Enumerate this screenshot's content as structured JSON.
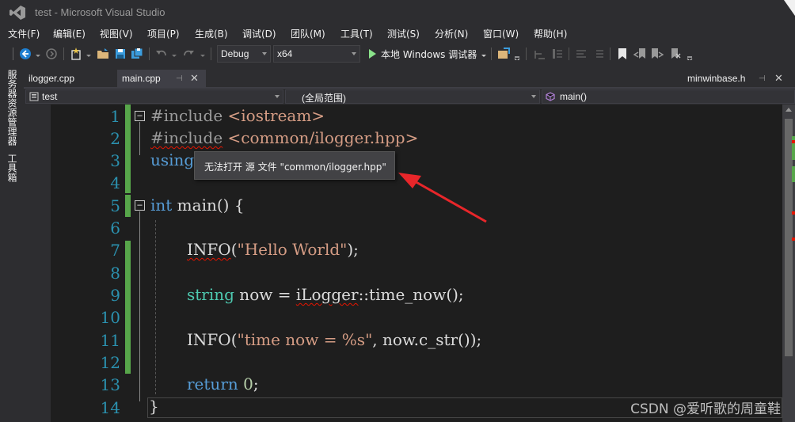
{
  "window": {
    "title": "test - Microsoft Visual Studio"
  },
  "menu": [
    "文件(F)",
    "编辑(E)",
    "视图(V)",
    "项目(P)",
    "生成(B)",
    "调试(D)",
    "团队(M)",
    "工具(T)",
    "测试(S)",
    "分析(N)",
    "窗口(W)",
    "帮助(H)"
  ],
  "toolbar": {
    "configuration": "Debug",
    "platform": "x64",
    "run_label": "本地 Windows 调试器"
  },
  "left_rail": {
    "server_explorer": "服务器资源管理器",
    "toolbox": "工具箱"
  },
  "tabs": [
    {
      "label": "ilogger.cpp",
      "active": false
    },
    {
      "label": "main.cpp",
      "active": true
    },
    {
      "label": "minwinbase.h",
      "active": false
    }
  ],
  "navbar": {
    "project": "test",
    "scope": "(全局范围)",
    "member": "main()"
  },
  "line_numbers": [
    "1",
    "2",
    "3",
    "4",
    "5",
    "6",
    "7",
    "8",
    "9",
    "10",
    "11",
    "12",
    "13",
    "14"
  ],
  "code": {
    "l1_directive": "#include",
    "l1_header": " <iostream>",
    "l2_directive": "#include",
    "l2_header": " <common/ilogger.hpp>",
    "l3_kw": "using",
    "l5_kw": "int",
    "l5_rest": " main() {",
    "l7_macro": "INFO",
    "l7_open": "(",
    "l7_str": "\"Hello World\"",
    "l7_close": ");",
    "l9_type": "string",
    "l9_mid": " now = ",
    "l9_ns": "iLogger",
    "l9_rest": "::time_now();",
    "l11_macro": "INFO",
    "l11_open": "(",
    "l11_str": "\"time now = %s\"",
    "l11_rest": ", now.c_str());",
    "l13_kw": "return",
    "l13_space": " ",
    "l13_num": "0",
    "l13_semi": ";",
    "l14_brace": "}"
  },
  "tooltip": {
    "text": "无法打开 源 文件 \"common/ilogger.hpp\""
  },
  "watermark": "CSDN @爱听歌的周童鞋",
  "colors": {
    "arrow": "#e8262a",
    "change_bar": "#57a64a",
    "error_squiggle": "#e51400"
  },
  "icons": [
    "visual-studio-logo-icon",
    "back-icon",
    "forward-icon",
    "new-project-icon",
    "open-folder-icon",
    "save-icon",
    "save-all-icon",
    "undo-icon",
    "redo-icon",
    "play-icon",
    "bookmark-icon"
  ]
}
